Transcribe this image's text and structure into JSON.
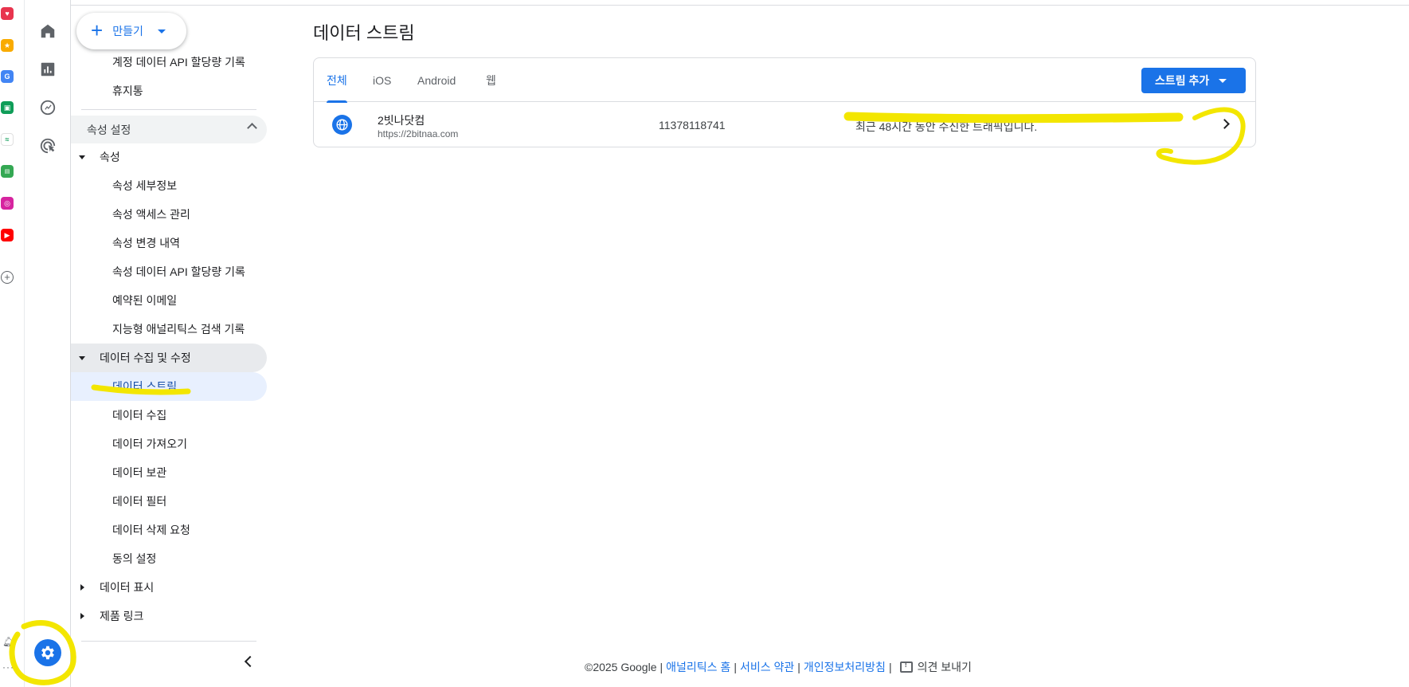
{
  "nav": {
    "create_label": "만들기",
    "top_items": [
      {
        "label": "계정 데이터 API 할당량 기록"
      },
      {
        "label": "휴지통"
      }
    ],
    "property_settings_header": "속성 설정",
    "property_group": {
      "label": "속성",
      "items": [
        {
          "label": "속성 세부정보"
        },
        {
          "label": "속성 액세스 관리"
        },
        {
          "label": "속성 변경 내역"
        },
        {
          "label": "속성 데이터 API 할당량 기록"
        },
        {
          "label": "예약된 이메일"
        },
        {
          "label": "지능형 애널리틱스 검색 기록"
        }
      ]
    },
    "data_group": {
      "label": "데이터 수집 및 수정",
      "items": [
        {
          "label": "데이터 스트림"
        },
        {
          "label": "데이터 수집"
        },
        {
          "label": "데이터 가져오기"
        },
        {
          "label": "데이터 보관"
        },
        {
          "label": "데이터 필터"
        },
        {
          "label": "데이터 삭제 요청"
        },
        {
          "label": "동의 설정"
        }
      ]
    },
    "display_group": {
      "label": "데이터 표시"
    },
    "links_group": {
      "label": "제품 링크"
    }
  },
  "main": {
    "title": "데이터 스트림",
    "tabs": [
      {
        "label": "전체"
      },
      {
        "label": "iOS"
      },
      {
        "label": "Android"
      },
      {
        "label": "웹"
      }
    ],
    "add_stream_label": "스트림 추가",
    "stream": {
      "name": "2빗나닷컴",
      "url": "https://2bitnaa.com",
      "id": "11378118741",
      "status": "최근 48시간 동안 수신한 트래픽입니다."
    }
  },
  "footer": {
    "copyright": "©2025 Google",
    "link_home": "애널리틱스 홈",
    "link_terms": "서비스 약관",
    "link_privacy": "개인정보처리방침",
    "feedback": "의견 보내기"
  },
  "colors": {
    "accent": "#1a73e8",
    "highlight": "#f3e600"
  }
}
